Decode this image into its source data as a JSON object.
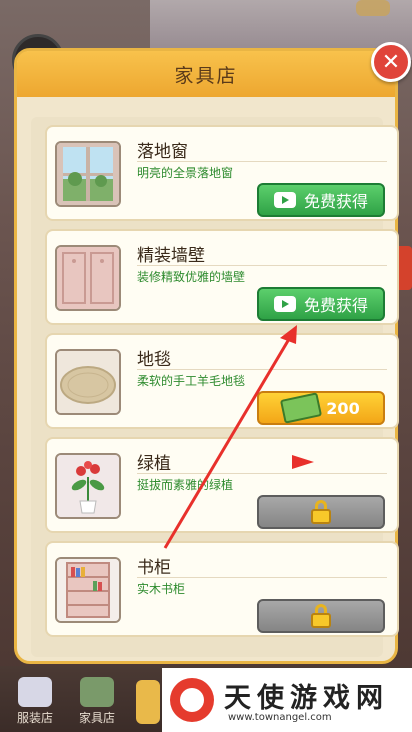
{
  "dialog": {
    "title": "家具店"
  },
  "items": [
    {
      "name": "落地窗",
      "desc": "明亮的全景落地窗",
      "button": {
        "type": "video",
        "label": "免费获得"
      },
      "thumb": "window-thumb"
    },
    {
      "name": "精装墙壁",
      "desc": "装修精致优雅的墙壁",
      "button": {
        "type": "video",
        "label": "免费获得"
      },
      "thumb": "wall-thumb"
    },
    {
      "name": "地毯",
      "desc": "柔软的手工羊毛地毯",
      "button": {
        "type": "price",
        "label": "200"
      },
      "thumb": "rug-thumb"
    },
    {
      "name": "绿植",
      "desc": "挺拔而素雅的绿植",
      "button": {
        "type": "locked"
      },
      "thumb": "plant-thumb"
    },
    {
      "name": "书柜",
      "desc": "实木书柜",
      "button": {
        "type": "locked"
      },
      "thumb": "bookshelf-thumb"
    }
  ],
  "bottom_tabs": [
    {
      "label": "服装店"
    },
    {
      "label": "家具店"
    }
  ],
  "watermark": {
    "name": "天使游戏网",
    "url": "www.townangel.com"
  },
  "colors": {
    "accent": "#f0b33a",
    "green_button": "#3db356",
    "gold_button": "#f7b920",
    "locked_button": "#8f8f8f",
    "arrow": "#e8302b"
  }
}
